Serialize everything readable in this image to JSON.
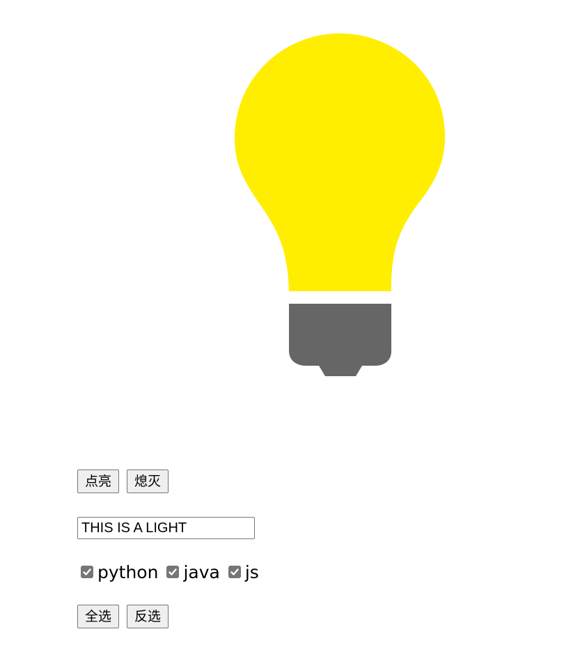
{
  "bulb": {
    "state": "on",
    "glass_color": "#ffee00",
    "base_color": "#666666"
  },
  "light_buttons": {
    "on_label": "点亮",
    "off_label": "熄灭"
  },
  "text_field": {
    "value": "THIS IS A LIGHT"
  },
  "checkboxes": [
    {
      "label": "python",
      "checked": true
    },
    {
      "label": "java",
      "checked": true
    },
    {
      "label": "js",
      "checked": true
    }
  ],
  "select_buttons": {
    "select_all_label": "全选",
    "invert_label": "反选"
  },
  "colors": {
    "checkbox_fill": "#767676",
    "button_bg": "#efefef",
    "button_border": "#767676"
  }
}
